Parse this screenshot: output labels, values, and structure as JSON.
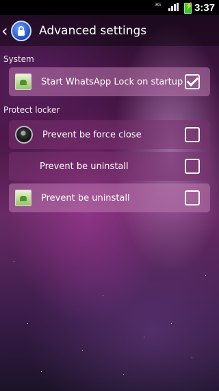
{
  "status_bar": {
    "network": "3G",
    "time": "3:37"
  },
  "header": {
    "title": "Advanced settings",
    "back_icon": "chevron-left-icon",
    "app_icon": "lock-app-icon"
  },
  "sections": [
    {
      "label": "System",
      "items": [
        {
          "label": "Start WhatsApp Lock on startup",
          "checked": true,
          "icon": "android-icon"
        }
      ]
    },
    {
      "label": "Protect locker",
      "items": [
        {
          "label": "Prevent be force close",
          "checked": false,
          "icon": "ball-icon"
        },
        {
          "label": "Prevent be uninstall",
          "checked": false,
          "icon": ""
        },
        {
          "label": "Prevent be uninstall",
          "checked": false,
          "icon": "android-icon"
        }
      ]
    }
  ]
}
